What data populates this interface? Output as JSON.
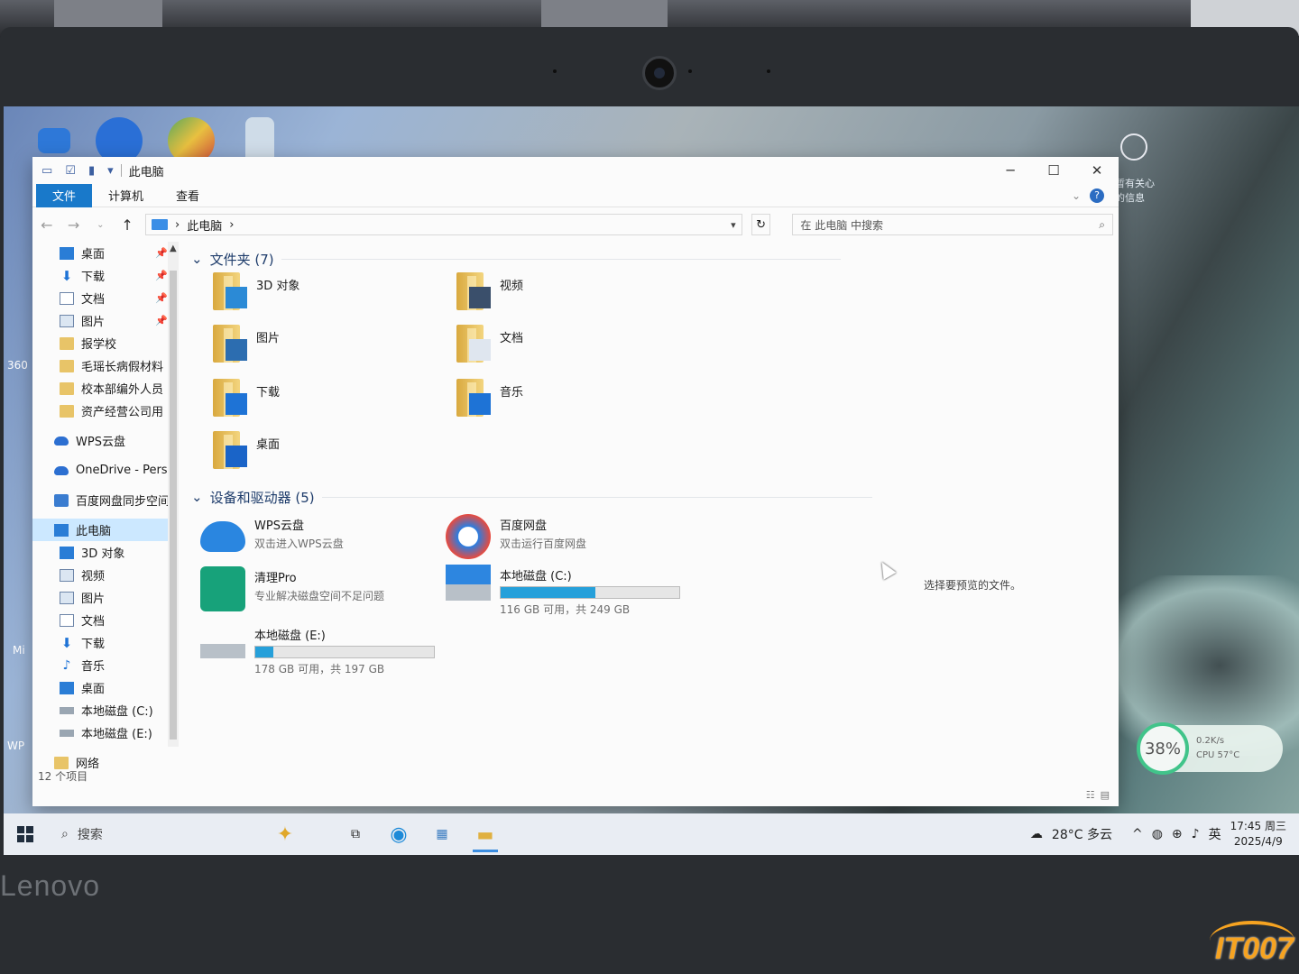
{
  "brand": "Lenovo",
  "watermark": "IT007",
  "desktop": {
    "left_labels": [
      "360",
      "Mi",
      "WP"
    ],
    "notification_text": "暂有关心的信息"
  },
  "window": {
    "title": "此电脑",
    "ribbon_tabs": [
      "文件",
      "计算机",
      "查看"
    ],
    "breadcrumb": "此电脑",
    "search_placeholder": "在 此电脑 中搜索",
    "status_count": "12 个项目",
    "preview_text": "选择要预览的文件。"
  },
  "nav": {
    "quick": [
      {
        "label": "桌面",
        "icon": "desktop-icon",
        "pinned": true
      },
      {
        "label": "下载",
        "icon": "download-icon",
        "pinned": true
      },
      {
        "label": "文档",
        "icon": "document-icon",
        "pinned": true
      },
      {
        "label": "图片",
        "icon": "picture-icon",
        "pinned": true
      },
      {
        "label": "报学校",
        "icon": "folder-icon",
        "pinned": false
      },
      {
        "label": "毛瑶长病假材料",
        "icon": "folder-icon",
        "pinned": false
      },
      {
        "label": "校本部编外人员",
        "icon": "folder-icon",
        "pinned": false
      },
      {
        "label": "资产经营公司用",
        "icon": "folder-icon",
        "pinned": false
      }
    ],
    "clouds": [
      {
        "label": "WPS云盘",
        "icon": "cloud-icon"
      },
      {
        "label": "OneDrive - Perso",
        "icon": "onedrive-icon"
      },
      {
        "label": "百度网盘同步空间",
        "icon": "baidu-sync-icon"
      }
    ],
    "this_pc": "此电脑",
    "pc_children": [
      {
        "label": "3D 对象",
        "icon": "3d-objects-icon"
      },
      {
        "label": "视频",
        "icon": "video-icon"
      },
      {
        "label": "图片",
        "icon": "picture-icon"
      },
      {
        "label": "文档",
        "icon": "document-icon"
      },
      {
        "label": "下载",
        "icon": "download-icon"
      },
      {
        "label": "音乐",
        "icon": "music-icon"
      },
      {
        "label": "桌面",
        "icon": "desktop-icon"
      },
      {
        "label": "本地磁盘 (C:)",
        "icon": "drive-icon"
      },
      {
        "label": "本地磁盘 (E:)",
        "icon": "drive-icon"
      }
    ],
    "network": "网络"
  },
  "folders_group": {
    "title": "文件夹 (7)",
    "items": [
      {
        "label": "3D 对象",
        "icon": "3d-objects-folder-icon"
      },
      {
        "label": "视频",
        "icon": "video-folder-icon"
      },
      {
        "label": "图片",
        "icon": "pictures-folder-icon"
      },
      {
        "label": "文档",
        "icon": "documents-folder-icon"
      },
      {
        "label": "下载",
        "icon": "downloads-folder-icon"
      },
      {
        "label": "音乐",
        "icon": "music-folder-icon"
      },
      {
        "label": "桌面",
        "icon": "desktop-folder-icon"
      }
    ]
  },
  "devices_group": {
    "title": "设备和驱动器 (5)",
    "items": [
      {
        "name": "WPS云盘",
        "sub": "双击进入WPS云盘",
        "icon": "wps-cloud-icon"
      },
      {
        "name": "百度网盘",
        "sub": "双击运行百度网盘",
        "icon": "baidu-netdisk-icon"
      },
      {
        "name": "清理Pro",
        "sub": "专业解决磁盘空间不足问题",
        "icon": "cleaner-pro-icon"
      },
      {
        "name": "本地磁盘 (C:)",
        "sub": "116 GB 可用，共 249 GB",
        "icon": "windows-drive-icon",
        "used_fraction": 0.53
      },
      {
        "name": "本地磁盘 (E:)",
        "sub": "178 GB 可用，共 197 GB",
        "icon": "drive-icon",
        "used_fraction": 0.1
      }
    ]
  },
  "taskbar": {
    "search_label": "搜索",
    "weather": "28°C  多云",
    "ime": "英",
    "time": "17:45 周三",
    "date": "2025/4/9"
  },
  "widget": {
    "percent": "38%",
    "net": "0.2K/s",
    "cpu": "CPU 57°C"
  }
}
